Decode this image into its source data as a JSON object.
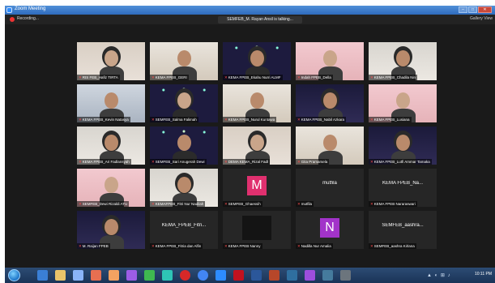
{
  "window": {
    "title": "Zoom Meeting"
  },
  "topbar": {
    "recording_label": "Recording...",
    "speaking": "SEMFEB_M. Rayan Ansil is talking...",
    "view_label": "Gallery View"
  },
  "tiles": [
    {
      "name": "RIS FEB_Hafiz TIRTA",
      "kind": "video"
    },
    {
      "name": "KEMA FPEB_GERI",
      "kind": "video"
    },
    {
      "name": "KEMA FPEB_Ekahu Nurri ALMF",
      "kind": "video"
    },
    {
      "name": "Indah FPEB_Della",
      "kind": "video"
    },
    {
      "name": "KEMA FPEB_Chadila Nin",
      "kind": "video"
    },
    {
      "name": "KEMA FPEB_Kevin Natasya",
      "kind": "video"
    },
    {
      "name": "SEMFEB_Salma Falimah",
      "kind": "video"
    },
    {
      "name": "KEMA FPEB_Nurul Kuntawa",
      "kind": "video"
    },
    {
      "name": "KEMA FPEB_Nabil Azkara",
      "kind": "video"
    },
    {
      "name": "KEMA FPEB_Lusiana",
      "kind": "video"
    },
    {
      "name": "KEMA FPEB_Ari Fadlansyah",
      "kind": "video"
    },
    {
      "name": "SEMFEB_Sari Anugerah Dewi",
      "kind": "video"
    },
    {
      "name": "DEMA KEMA_Rizal Fadl",
      "kind": "video"
    },
    {
      "name": "Gita Pramarsela",
      "kind": "video"
    },
    {
      "name": "KEMA FPEB_Lutfi Ammar Tamaka",
      "kind": "video"
    },
    {
      "name": "SEMFEB_Dewi Rizaldi ATU",
      "kind": "video"
    },
    {
      "name": "KEMAFPEB_Fitri Nur Nadilah",
      "kind": "video"
    },
    {
      "name": "SEMFEB_Ghaessih",
      "kind": "avatar",
      "label": "M",
      "color": "#e0306f"
    },
    {
      "name": "mutfila",
      "kind": "text",
      "label": "mutfila"
    },
    {
      "name": "KEMA FPEB Nararaswari",
      "kind": "text",
      "label": "KEMA FPEB_Na..."
    },
    {
      "name": "M. Raijan FPEB",
      "kind": "video"
    },
    {
      "name": "KEMA FPEB_Fitria dan Alfin",
      "kind": "text",
      "label": "KEMA_FPEB_Fitri..."
    },
    {
      "name": "KEMA FPEB Nanny",
      "kind": "blank"
    },
    {
      "name": "Nadilla Nur Amalia",
      "kind": "avatar",
      "label": "N",
      "color": "#a233c9"
    },
    {
      "name": "SEMFEB_aashra Kirlana",
      "kind": "text",
      "label": "SEMFEB_aashra..."
    }
  ],
  "clock": {
    "time": "10:11 PM"
  }
}
